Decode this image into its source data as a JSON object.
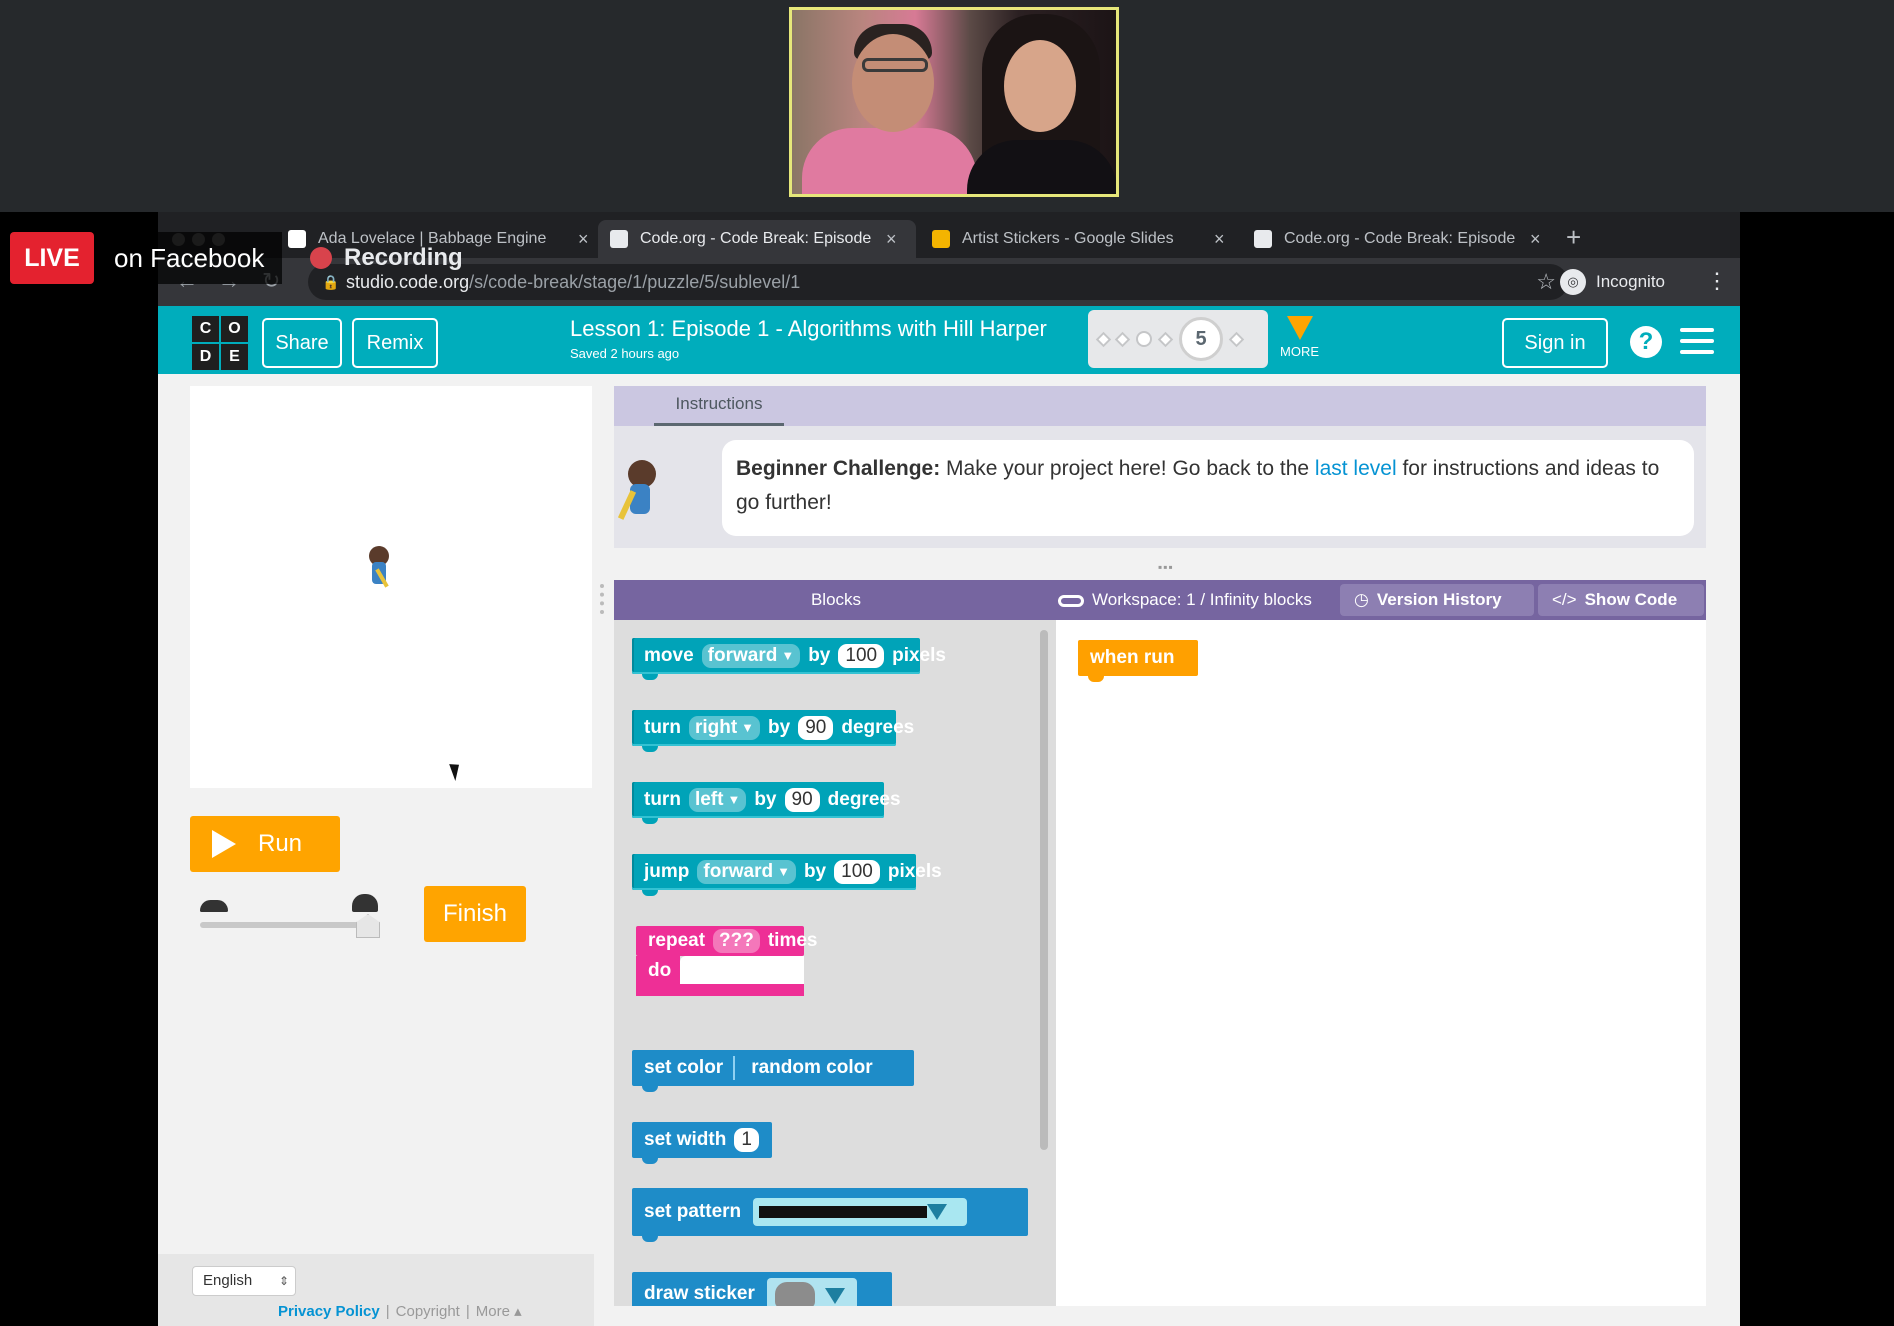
{
  "overlay": {
    "live": "LIVE",
    "on_facebook": "on Facebook",
    "recording": "Recording"
  },
  "browser": {
    "tabs": [
      {
        "title": "Ada Lovelace | Babbage Engine",
        "favicon_color": "#ffffff",
        "active": false
      },
      {
        "title": "Code.org - Code Break: Episode",
        "favicon_color": "#e8eaed",
        "active": true
      },
      {
        "title": "Artist Stickers - Google Slides",
        "favicon_color": "#f4b400",
        "active": false
      },
      {
        "title": "Code.org - Code Break: Episode",
        "favicon_color": "#e8eaed",
        "active": false
      }
    ],
    "url_host": "studio.code.org",
    "url_path": "/s/code-break/stage/1/puzzle/5/sublevel/1",
    "incognito": "Incognito"
  },
  "header": {
    "logo_letters": [
      "C",
      "O",
      "D",
      "E"
    ],
    "share_label": "Share",
    "remix_label": "Remix",
    "lesson_title": "Lesson 1: Episode 1 - Algorithms with Hill Harper",
    "saved_text": "Saved 2 hours ago",
    "current_level": "5",
    "more_label": "MORE",
    "signin_label": "Sign in",
    "accent": "#00adbc"
  },
  "run": {
    "run_label": "Run",
    "finish_label": "Finish"
  },
  "footer": {
    "language": "English",
    "privacy": "Privacy Policy",
    "copyright": "Copyright",
    "more": "More ▴"
  },
  "instructions": {
    "tab": "Instructions",
    "challenge_label": "Beginner Challenge:",
    "text_before_link": " Make your project here! Go back to the ",
    "link_text": "last level",
    "text_after_link": " for instructions and ideas to go further!"
  },
  "blocks_header": {
    "blocks_label": "Blocks",
    "workspace_label": "Workspace: 1 / Infinity blocks",
    "version_history": "Version History",
    "show_code": "Show Code"
  },
  "toolbox": {
    "move": {
      "verb": "move",
      "dir": "forward",
      "by": "by",
      "amount": "100",
      "unit": "pixels"
    },
    "turn_right": {
      "verb": "turn",
      "dir": "right",
      "by": "by",
      "amount": "90",
      "unit": "degrees"
    },
    "turn_left": {
      "verb": "turn",
      "dir": "left",
      "by": "by",
      "amount": "90",
      "unit": "degrees"
    },
    "jump": {
      "verb": "jump",
      "dir": "forward",
      "by": "by",
      "amount": "100",
      "unit": "pixels"
    },
    "repeat": {
      "verb": "repeat",
      "count": "???",
      "times": "times",
      "do": "do"
    },
    "set_color": {
      "label": "set color",
      "value": "random color"
    },
    "set_width": {
      "label": "set width",
      "value": "1"
    },
    "set_pattern": {
      "label": "set pattern"
    },
    "draw_sticker": {
      "label": "draw sticker"
    }
  },
  "workspace": {
    "when_run": "when run"
  }
}
